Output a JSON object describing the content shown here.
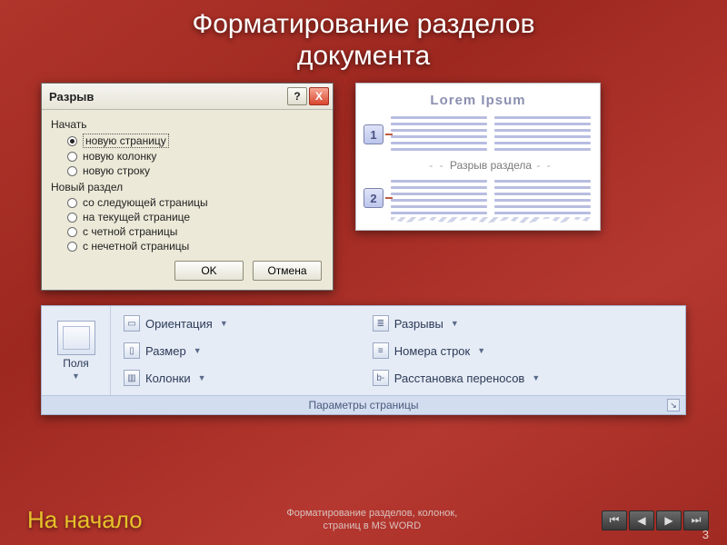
{
  "slide": {
    "title_line1": "Форматирование разделов",
    "title_line2": "документа"
  },
  "dialog": {
    "title": "Разрыв",
    "group_begin": "Начать",
    "begin_options": [
      {
        "label": "новую страницу",
        "checked": true
      },
      {
        "label": "новую колонку",
        "checked": false
      },
      {
        "label": "новую строку",
        "checked": false
      }
    ],
    "group_section": "Новый раздел",
    "section_options": [
      {
        "label": "со следующей страницы"
      },
      {
        "label": "на текущей странице"
      },
      {
        "label": "с четной страницы"
      },
      {
        "label": "с нечетной страницы"
      }
    ],
    "ok": "OK",
    "cancel": "Отмена",
    "help": "?",
    "close": "X"
  },
  "diagram": {
    "title": "Lorem Ipsum",
    "badge1": "1",
    "badge2": "2",
    "break_label": "Разрыв раздела"
  },
  "ribbon": {
    "big": {
      "label": "Поля"
    },
    "items": {
      "orientation": "Ориентация",
      "breaks": "Разрывы",
      "size": "Размер",
      "linenum": "Номера строк",
      "columns": "Колонки",
      "hyphen": "Расстановка переносов"
    },
    "caption": "Параметры страницы"
  },
  "footer": {
    "start": "На начало",
    "mid_line1": "Форматирование разделов, колонок,",
    "mid_line2": "страниц в MS WORD",
    "slidenum": "3"
  }
}
